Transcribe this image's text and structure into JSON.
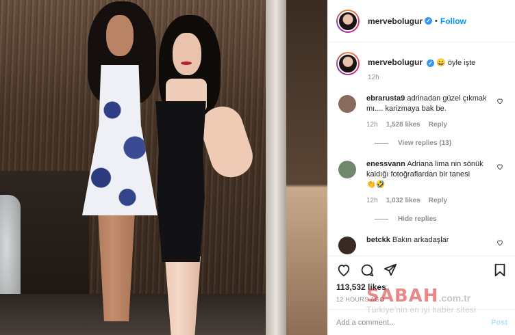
{
  "post": {
    "username": "mervebolugur",
    "follow_label": "Follow",
    "separator": "•",
    "caption_emoji": "😀",
    "caption_text": "öyle işte",
    "caption_time": "12h"
  },
  "comments": [
    {
      "user": "ebrarusta9",
      "text": "adrinadan güzel çıkmak mı.... karizmaya bak be.",
      "time": "12h",
      "likes": "1,528 likes",
      "reply": "Reply",
      "replies_toggle": "View replies (13)",
      "avatar_color": "#8a6a5c"
    },
    {
      "user": "enessvann",
      "text": "Adriana lima nin sönük kaldığı fotoğraflardan bir tanesi",
      "emojis": "👏🤣",
      "time": "12h",
      "likes": "1,032 likes",
      "reply": "Reply",
      "replies_toggle": "Hide replies",
      "avatar_color": "#6f8a6a"
    },
    {
      "user": "betckk",
      "text": "Bakın arkadaşlar",
      "avatar_color": "#3b2a24"
    }
  ],
  "actions": {
    "likes": "113,532 likes",
    "time": "12 HOURS AGO",
    "comment_placeholder": "Add a comment...",
    "post_label": "Post"
  },
  "watermark": {
    "logo": "SABAH",
    "domain": ".com.tr",
    "tagline": "Türkiye'nin en iyi haber sitesi"
  },
  "colors": {
    "accent": "#0095f6",
    "verified": "#3897f0",
    "muted": "#8e8e8e"
  }
}
